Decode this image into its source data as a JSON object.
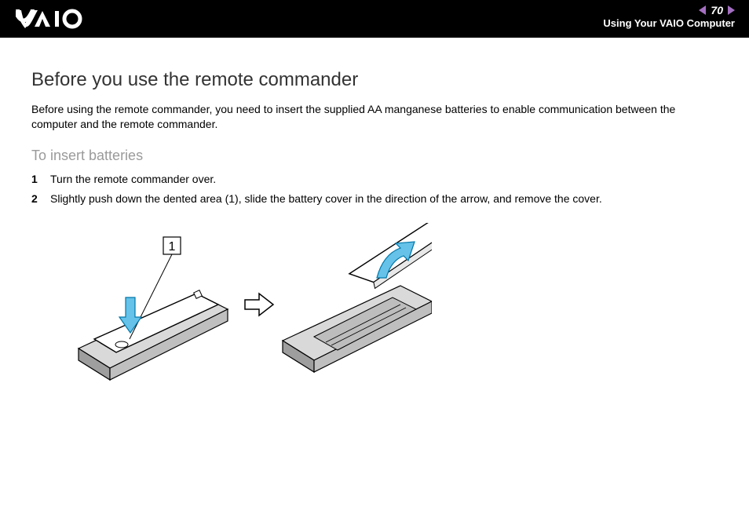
{
  "header": {
    "page_number": "70",
    "section_title": "Using Your VAIO Computer"
  },
  "title": "Before you use the remote commander",
  "intro": "Before using the remote commander, you need to insert the supplied AA manganese batteries to enable communication between the computer and the remote commander.",
  "subheading": "To insert batteries",
  "steps": [
    {
      "num": "1",
      "text": "Turn the remote commander over."
    },
    {
      "num": "2",
      "text": "Slightly push down the dented area (1), slide the battery cover in the direction of the arrow, and remove the cover."
    }
  ],
  "figure": {
    "callout": "1"
  }
}
